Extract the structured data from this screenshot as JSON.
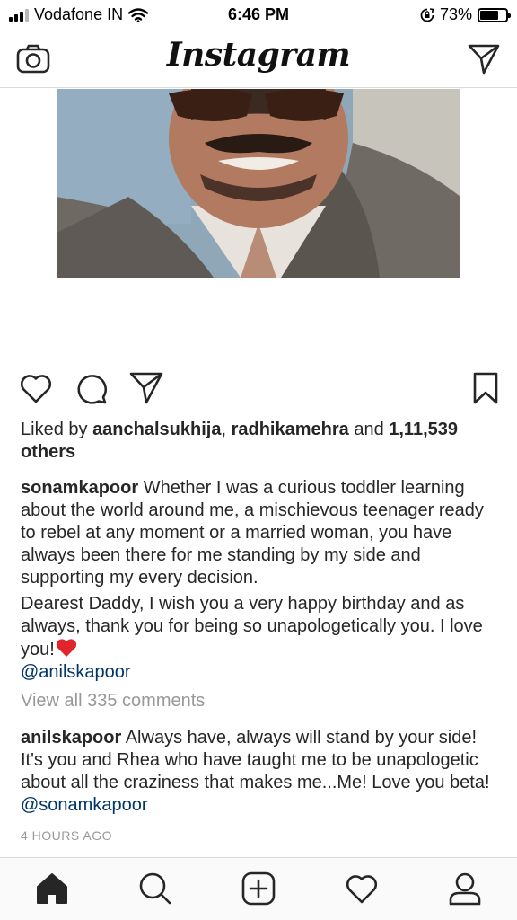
{
  "status_bar": {
    "carrier": "Vodafone IN",
    "time": "6:46 PM",
    "battery": "73%",
    "battery_level": 0.73
  },
  "header": {
    "logo": "Instagram",
    "left_icon": "camera-icon",
    "right_icon": "direct-message-icon"
  },
  "post": {
    "likes": {
      "prefix": "Liked by ",
      "user1": "aanchalsukhija",
      "separator": ", ",
      "user2": "radhikamehra",
      "middle": " and ",
      "count": "1,11,539 others"
    },
    "caption": {
      "username": "sonamkapoor",
      "text1": " Whether I was a curious toddler learning about the world around me, a mischievous teenager ready to rebel at any moment or a married woman, you have always been there for me standing by my side and supporting my every decision.",
      "text2": "Dearest Daddy, I wish you a very happy birthday and as always, thank you for being so unapologetically you. I love you!",
      "emoji": "❤️",
      "mention": "@anilskapoor"
    },
    "view_all": "View all 335 comments",
    "comment": {
      "username": "anilskapoor",
      "text": " Always have, always will stand by your side! It's you and Rhea who have taught me to be unapologetic about all the craziness that makes me...Me! Love you beta! ",
      "mention": "@sonamkapoor"
    },
    "timestamp": "4 HOURS AGO"
  },
  "tabs": [
    "home-icon",
    "search-icon",
    "new-post-icon",
    "activity-icon",
    "profile-icon"
  ],
  "colors": {
    "text": "#262626",
    "mention": "#003569",
    "muted": "#999999",
    "heart": "#e0262c",
    "divider": "#dbdbdb"
  }
}
